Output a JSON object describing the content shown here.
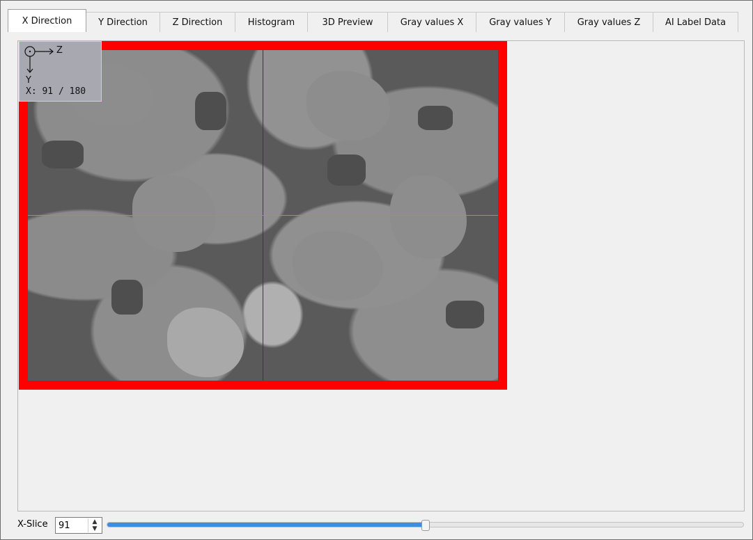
{
  "tabs": [
    {
      "label": "X Direction",
      "active": true
    },
    {
      "label": "Y Direction",
      "active": false
    },
    {
      "label": "Z Direction",
      "active": false
    },
    {
      "label": "Histogram",
      "active": false
    },
    {
      "label": "3D Preview",
      "active": false
    },
    {
      "label": "Gray values X",
      "active": false
    },
    {
      "label": "Gray values Y",
      "active": false
    },
    {
      "label": "Gray values Z",
      "active": false
    },
    {
      "label": "AI Label Data",
      "active": false
    }
  ],
  "view": {
    "axis_horizontal": "Z",
    "axis_vertical": "Y",
    "slice_readout": "X: 91 / 180",
    "frame_color": "#ff0000",
    "crosshair_vertical_color": "#1c2bd9",
    "crosshair_horizontal_color": "#2fd62f",
    "overlay_border_color": "#f4e400"
  },
  "slice_control": {
    "label": "X-Slice",
    "value": "91",
    "max": 180,
    "slider_fraction": 0.5,
    "slider_color": "#3b8ee0"
  }
}
